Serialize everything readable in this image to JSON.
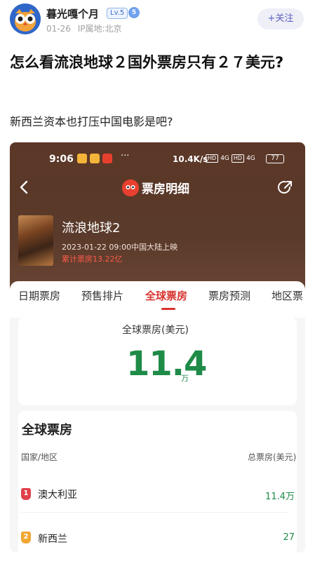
{
  "post": {
    "username": "暮光嘎个月",
    "level": "Lv.5",
    "vip": "5",
    "date": "01-26",
    "ip": "IP属地:北京",
    "follow_label": "+关注",
    "title": "怎么看流浪地球２国外票房只有２７美元?",
    "body": "新西兰资本也打压中国电影是吧?"
  },
  "screenshot": {
    "status": {
      "time": "9:06",
      "dots": "···",
      "speed": "10.4K/s",
      "net1": "HD",
      "net2": "4G",
      "net3": "HD",
      "net4": "4G",
      "battery": "77"
    },
    "nav": {
      "title": "票房明细"
    },
    "film": {
      "name": "流浪地球2",
      "release": "2023-01-22 09:00中国大陆上映",
      "total": "累计票房13.22亿"
    },
    "tabs": [
      {
        "label": "日期票房"
      },
      {
        "label": "预售排片"
      },
      {
        "label": "全球票房"
      },
      {
        "label": "票房预测"
      },
      {
        "label": "地区票"
      }
    ],
    "global": {
      "label": "全球票房(美元)",
      "value": "11.4",
      "unit": "万"
    },
    "table": {
      "title": "全球票房",
      "col_left": "国家/地区",
      "col_right": "总票房(美元)",
      "rows": [
        {
          "rank": "1",
          "country": "澳大利亚",
          "amount": "11.4万"
        },
        {
          "rank": "2",
          "country": "新西兰",
          "amount": "27"
        }
      ]
    }
  },
  "colors": {
    "accent_red": "#d8332e",
    "box_office_green": "#1f8b48",
    "header_brown": "#5b3727",
    "follow_purple": "#5a5ec2"
  }
}
